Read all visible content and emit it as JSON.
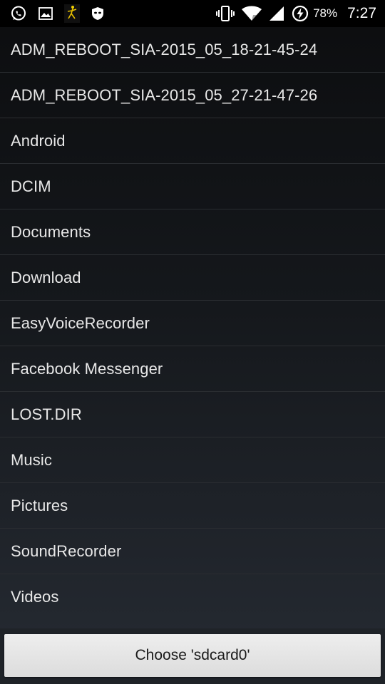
{
  "status_bar": {
    "left_icons": [
      "whatsapp-icon",
      "gallery-icon",
      "app-figure-icon",
      "incognito-mask-icon"
    ],
    "right_icons": [
      "vibrate-icon",
      "wifi-icon",
      "signal-icon",
      "battery-charging-icon"
    ],
    "battery": "78%",
    "time": "7:27"
  },
  "folders": [
    "ADM_REBOOT_SIA-2015_05_18-21-45-24",
    "ADM_REBOOT_SIA-2015_05_27-21-47-26",
    "Android",
    "DCIM",
    "Documents",
    "Download",
    "EasyVoiceRecorder",
    "Facebook Messenger",
    "LOST.DIR",
    "Music",
    "Pictures",
    "SoundRecorder",
    "Videos"
  ],
  "choose_button": {
    "label": "Choose 'sdcard0'"
  },
  "colors": {
    "status_bar_bg": "#000000",
    "list_text": "#e8e8e8",
    "divider": "#2a2d31",
    "button_bg": "#e4e4e4",
    "button_text": "#1a1a1a"
  }
}
